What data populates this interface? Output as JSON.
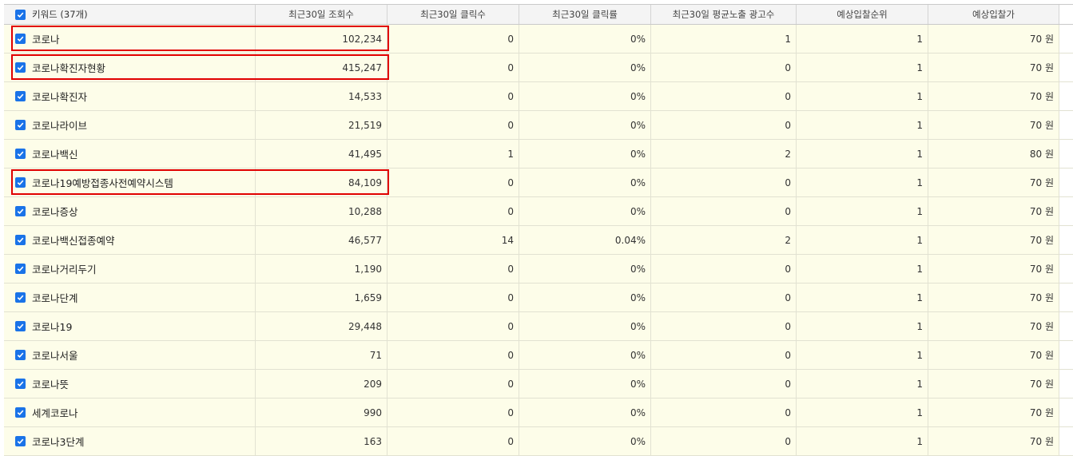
{
  "header": {
    "keyword_label": "키워드 (37개)",
    "columns": [
      "최근30일 조회수",
      "최근30일 클릭수",
      "최근30일 클릭률",
      "최근30일 평균노출 광고수",
      "예상입찰순위",
      "예상입찰가"
    ]
  },
  "rows": [
    {
      "keyword": "코로나",
      "views": "102,234",
      "clicks": "0",
      "ctr": "0%",
      "ads": "1",
      "rank": "1",
      "bid": "70 원",
      "highlighted": true
    },
    {
      "keyword": "코로나확진자현황",
      "views": "415,247",
      "clicks": "0",
      "ctr": "0%",
      "ads": "0",
      "rank": "1",
      "bid": "70 원",
      "highlighted": true
    },
    {
      "keyword": "코로나확진자",
      "views": "14,533",
      "clicks": "0",
      "ctr": "0%",
      "ads": "0",
      "rank": "1",
      "bid": "70 원",
      "highlighted": false
    },
    {
      "keyword": "코로나라이브",
      "views": "21,519",
      "clicks": "0",
      "ctr": "0%",
      "ads": "0",
      "rank": "1",
      "bid": "70 원",
      "highlighted": false
    },
    {
      "keyword": "코로나백신",
      "views": "41,495",
      "clicks": "1",
      "ctr": "0%",
      "ads": "2",
      "rank": "1",
      "bid": "80 원",
      "highlighted": false
    },
    {
      "keyword": "코로나19예방접종사전예약시스템",
      "views": "84,109",
      "clicks": "0",
      "ctr": "0%",
      "ads": "0",
      "rank": "1",
      "bid": "70 원",
      "highlighted": true
    },
    {
      "keyword": "코로나증상",
      "views": "10,288",
      "clicks": "0",
      "ctr": "0%",
      "ads": "0",
      "rank": "1",
      "bid": "70 원",
      "highlighted": false
    },
    {
      "keyword": "코로나백신접종예약",
      "views": "46,577",
      "clicks": "14",
      "ctr": "0.04%",
      "ads": "2",
      "rank": "1",
      "bid": "70 원",
      "highlighted": false
    },
    {
      "keyword": "코로나거리두기",
      "views": "1,190",
      "clicks": "0",
      "ctr": "0%",
      "ads": "0",
      "rank": "1",
      "bid": "70 원",
      "highlighted": false
    },
    {
      "keyword": "코로나단계",
      "views": "1,659",
      "clicks": "0",
      "ctr": "0%",
      "ads": "0",
      "rank": "1",
      "bid": "70 원",
      "highlighted": false
    },
    {
      "keyword": "코로나19",
      "views": "29,448",
      "clicks": "0",
      "ctr": "0%",
      "ads": "0",
      "rank": "1",
      "bid": "70 원",
      "highlighted": false
    },
    {
      "keyword": "코로나서울",
      "views": "71",
      "clicks": "0",
      "ctr": "0%",
      "ads": "0",
      "rank": "1",
      "bid": "70 원",
      "highlighted": false
    },
    {
      "keyword": "코로나뜻",
      "views": "209",
      "clicks": "0",
      "ctr": "0%",
      "ads": "0",
      "rank": "1",
      "bid": "70 원",
      "highlighted": false
    },
    {
      "keyword": "세계코로나",
      "views": "990",
      "clicks": "0",
      "ctr": "0%",
      "ads": "0",
      "rank": "1",
      "bid": "70 원",
      "highlighted": false
    },
    {
      "keyword": "코로나3단계",
      "views": "163",
      "clicks": "0",
      "ctr": "0%",
      "ads": "0",
      "rank": "1",
      "bid": "70 원",
      "highlighted": false
    }
  ],
  "colors": {
    "row_bg": "#fdfde9",
    "checkbox": "#1a73e8",
    "highlight_border": "#e00000",
    "header_bg": "#f4f4f4"
  }
}
